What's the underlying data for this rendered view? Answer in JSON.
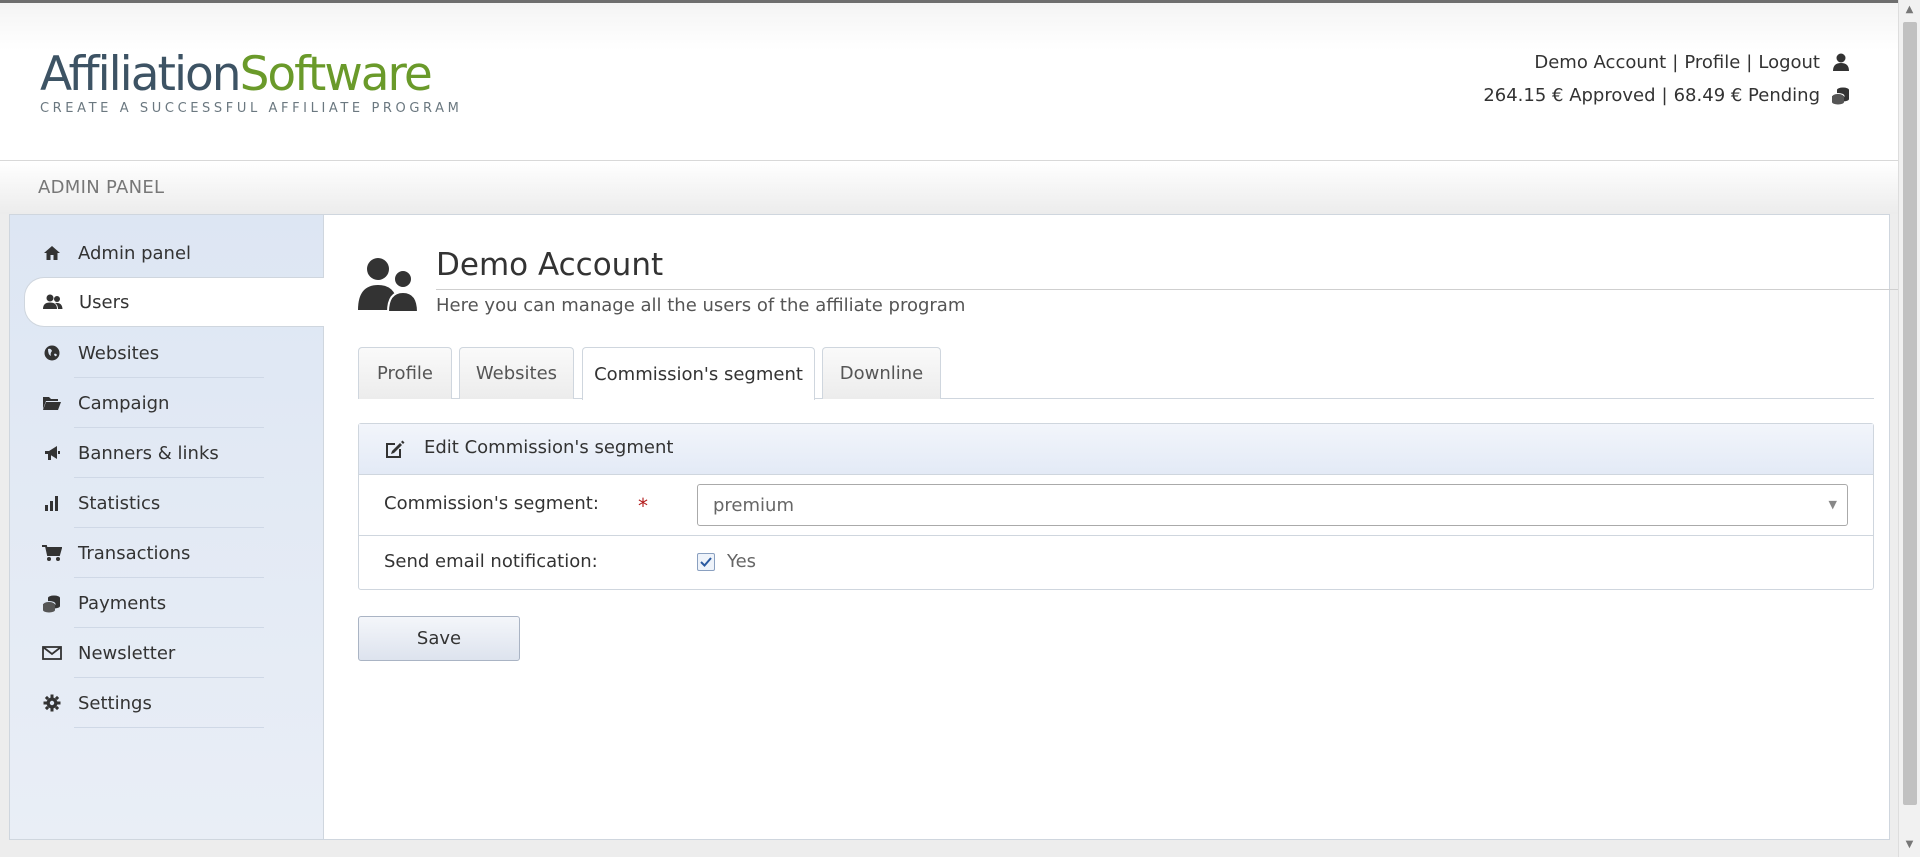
{
  "header": {
    "logo_part1": "Affiliation",
    "logo_part2": "Software",
    "logo_tagline": "CREATE A SUCCESSFUL AFFILIATE PROGRAM",
    "account_name": "Demo Account",
    "profile_link": "Profile",
    "logout_link": "Logout",
    "approved": "264.15 € Approved",
    "pending": "68.49 € Pending",
    "separator": "|"
  },
  "panel_bar": {
    "title": "ADMIN PANEL"
  },
  "sidebar": {
    "items": [
      {
        "label": "Admin panel",
        "icon": "home-icon"
      },
      {
        "label": "Users",
        "icon": "users-icon"
      },
      {
        "label": "Websites",
        "icon": "globe-icon"
      },
      {
        "label": "Campaign",
        "icon": "folder-open-icon"
      },
      {
        "label": "Banners & links",
        "icon": "megaphone-icon"
      },
      {
        "label": "Statistics",
        "icon": "bar-chart-icon"
      },
      {
        "label": "Transactions",
        "icon": "shopping-cart-icon"
      },
      {
        "label": "Payments",
        "icon": "coins-icon"
      },
      {
        "label": "Newsletter",
        "icon": "envelope-icon"
      },
      {
        "label": "Settings",
        "icon": "gear-icon"
      }
    ],
    "active": "Users"
  },
  "page": {
    "title": "Demo Account",
    "subtitle": "Here you can manage all the users of the affiliate program"
  },
  "tabs": [
    {
      "label": "Profile"
    },
    {
      "label": "Websites"
    },
    {
      "label": "Commission's segment"
    },
    {
      "label": "Downline"
    }
  ],
  "active_tab": "Commission's segment",
  "form": {
    "heading": "Edit Commission's segment",
    "segment_label": "Commission's segment:",
    "required_mark": "*",
    "segment_value": "premium",
    "notify_label": "Send email notification:",
    "notify_checked": true,
    "notify_option": "Yes",
    "save_label": "Save"
  },
  "colors": {
    "logo_dark": "#3d5364",
    "logo_green": "#6a9a2a",
    "sidebar_bg": "#dde6f3",
    "required": "#b31b1b"
  }
}
